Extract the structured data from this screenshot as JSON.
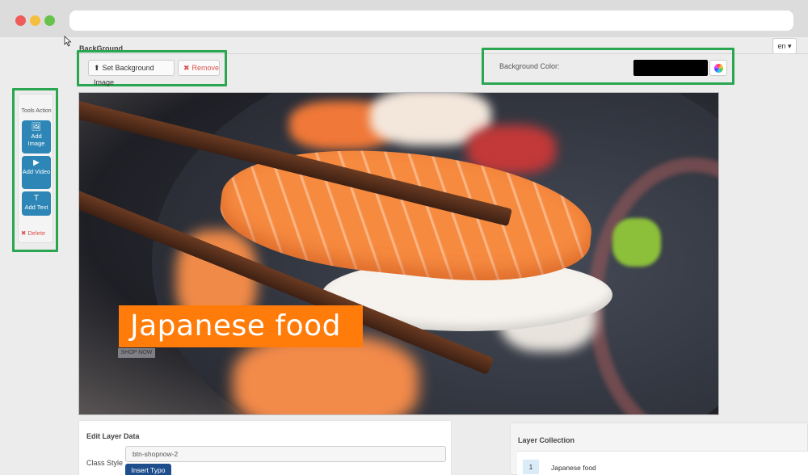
{
  "browser": {
    "url": ""
  },
  "header": {
    "section_title": "BackGround",
    "language": "en",
    "language_caret": "▾"
  },
  "background": {
    "set_image_icon": "upload-icon",
    "set_image_label": "Set Background Image",
    "remove_icon": "x-icon",
    "remove_label": "Remove",
    "color_label": "Background Color:",
    "color_value": "#000000"
  },
  "tools": {
    "title": "Tools Action",
    "add_image": "Add Image",
    "add_video": "Add Video",
    "add_text": "Add Text",
    "delete": "Delete"
  },
  "canvas": {
    "caption": "Japanese food",
    "shop_button": "SHOP NOW"
  },
  "edit_layer": {
    "title": "Edit Layer Data",
    "class_style_label": "Class Style",
    "class_style_value": "btn-shopnow-2",
    "insert_typo": "Insert Typo"
  },
  "layer_collection": {
    "title": "Layer Collection",
    "items": [
      {
        "index": "1",
        "name": "Japanese food"
      }
    ]
  },
  "colors": {
    "highlight": "#2aa651",
    "accent_blue": "#2d86b6",
    "caption_bg": "#ff7c0a",
    "danger": "#d9534f"
  }
}
